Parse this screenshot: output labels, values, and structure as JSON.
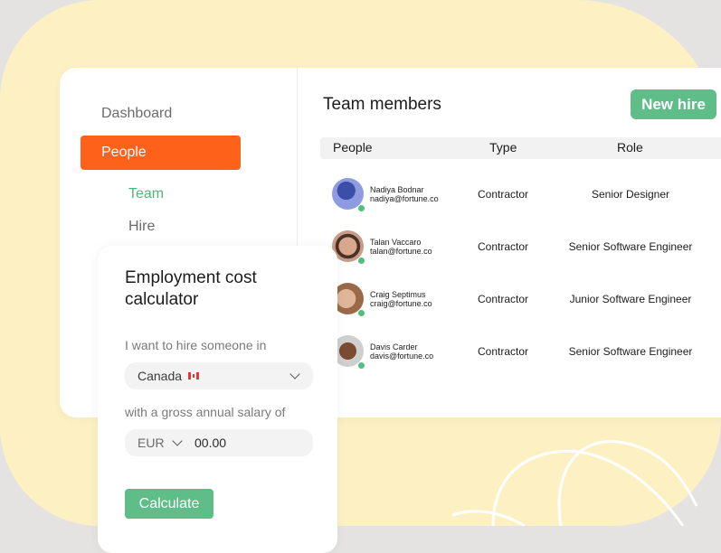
{
  "sidebar": {
    "items": [
      {
        "label": "Dashboard",
        "active": false
      },
      {
        "label": "People",
        "active": true
      },
      {
        "label": "Team",
        "active": true
      },
      {
        "label": "Hire",
        "active": false
      }
    ]
  },
  "main": {
    "title": "Team members",
    "new_hire_label": "New hire",
    "table": {
      "headers": [
        "People",
        "Type",
        "Role"
      ],
      "rows": [
        {
          "name": "Nadiya Bodnar",
          "email": "nadiya@fortune.co",
          "type": "Contractor",
          "role": "Senior Designer",
          "status": "online"
        },
        {
          "name": "Talan Vaccaro",
          "email": "talan@fortune.co",
          "type": "Contractor",
          "role": "Senior Software Engineer",
          "status": "online"
        },
        {
          "name": "Craig Septimus",
          "email": "craig@fortune.co",
          "type": "Contractor",
          "role": "Junior Software Engineer",
          "status": "online"
        },
        {
          "name": "Davis Carder",
          "email": "davis@fortune.co",
          "type": "Contractor",
          "role": "Senior Software Engineer",
          "status": "online"
        }
      ]
    }
  },
  "calculator": {
    "title": "Employment cost calculator",
    "country_label": "I want to hire someone in",
    "country_value": "Canada",
    "salary_label": "with a gross annual salary of",
    "currency": "EUR",
    "salary_value": "00.00",
    "button_label": "Calculate"
  },
  "colors": {
    "accent_orange": "#fd611a",
    "accent_green": "#5fbd87",
    "background_yellow": "#fdf1c4"
  }
}
